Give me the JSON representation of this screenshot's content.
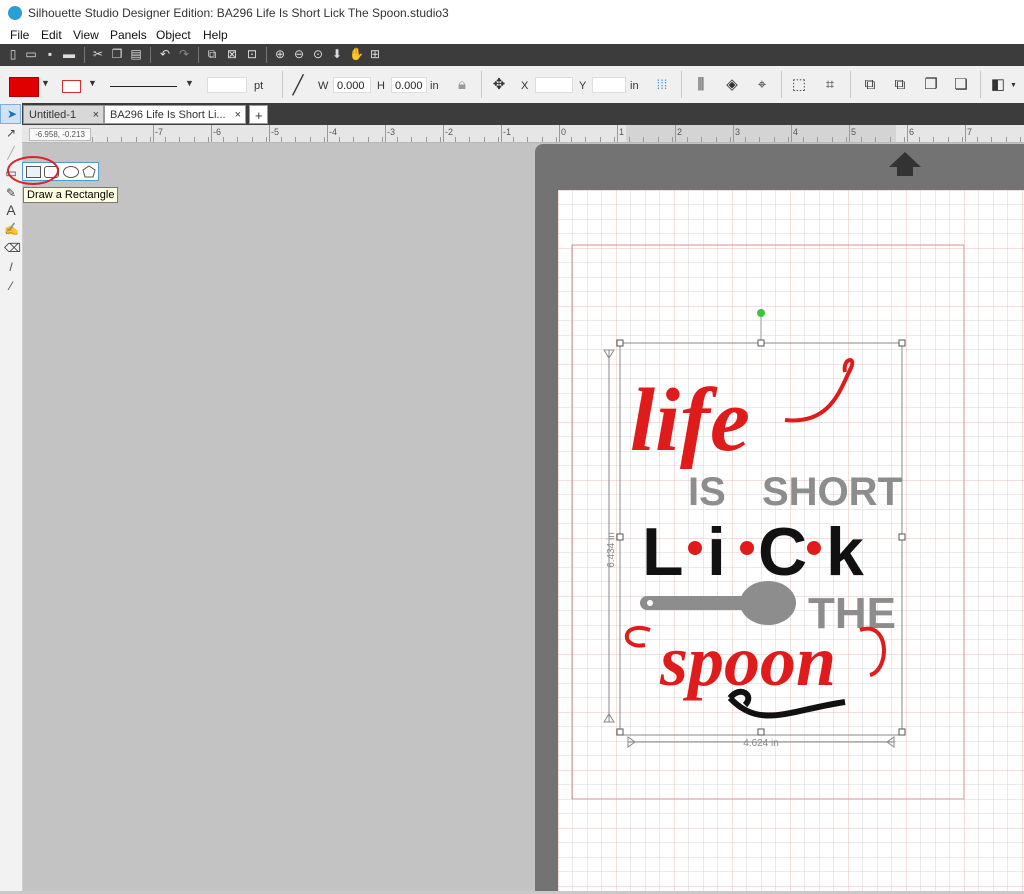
{
  "window": {
    "title": "Silhouette Studio Designer Edition: BA296 Life Is Short Lick The Spoon.studio3"
  },
  "menu": {
    "items": [
      "File",
      "Edit",
      "View",
      "Panels",
      "Object",
      "Help"
    ]
  },
  "properties": {
    "stroke_unit": "pt",
    "w_label": "W",
    "w_value": "0.000",
    "h_label": "H",
    "h_value": "0.000",
    "size_unit": "in",
    "x_label": "X",
    "y_label": "Y",
    "pos_unit": "in",
    "fill_color": "#e00000",
    "line_color": "#d32f2f"
  },
  "tabs": [
    {
      "label": "Untitled-1",
      "close": "×"
    },
    {
      "label": "BA296 Life Is Short Li...",
      "close": "×"
    }
  ],
  "add_tab_label": "+",
  "ruler": {
    "coords": "-6.958, -0.213",
    "labels": [
      "-7",
      "-6",
      "-5",
      "-4",
      "-3",
      "-2",
      "-1",
      "0",
      "1",
      "2",
      "3",
      "4",
      "5",
      "6",
      "7"
    ]
  },
  "tooltip": "Draw a Rectangle",
  "design": {
    "word_life": "life",
    "word_is": "IS",
    "word_short": "SHORT",
    "letters_lick": [
      "L",
      "i",
      "C",
      "k"
    ],
    "word_the": "THE",
    "word_spoon": "spoon",
    "width_dim": "4.624 in",
    "height_dim": "6.434 in",
    "colors": {
      "red": "#e01b1b",
      "gray": "#8d8d8d",
      "black": "#111111"
    }
  },
  "icons": {
    "toolbar": [
      "new-icon",
      "open-icon",
      "save-icon",
      "print-icon",
      "cut-icon",
      "copy-icon",
      "paste-icon",
      "undo-icon",
      "redo-icon",
      "group-icon",
      "ungroup-icon",
      "compound-icon",
      "zoom-in-icon",
      "zoom-out-icon",
      "zoom-fit-icon",
      "move-down-icon",
      "pan-icon",
      "fit-page-icon"
    ]
  }
}
